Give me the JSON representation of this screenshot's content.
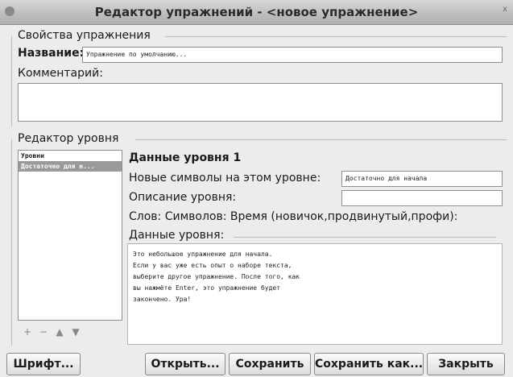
{
  "window": {
    "title": "Редактор упражнений - <новое упражнение>",
    "close_label": "x"
  },
  "properties": {
    "section_title": "Свойства упражнения",
    "name_label": "Название:",
    "name_value": "Упражнение по умолчанию...",
    "comment_label": "Комментарий:",
    "comment_value": ""
  },
  "level_editor": {
    "section_title": "Редактор уровня",
    "list_items": [
      {
        "label": "Уровни",
        "kind": "header"
      },
      {
        "label": "Достаточно для н...",
        "kind": "selected"
      }
    ],
    "level_title": "Данные уровня 1",
    "new_symbols_label": "Новые символы на этом уровне:",
    "new_symbols_value": "Достаточно для начала",
    "description_label": "Описание уровня:",
    "description_value": "",
    "stats_label": "Слов: Символов: Время (новичок,продвинутый,профи):",
    "data_label": "Данные уровня:",
    "data_text": "Это небольшое упражнение для начала.\nЕсли у вас уже есть опыт о наборе текста,\nвыберите другое упражнение. После того, как\nвы нажмёте Enter, это упражнение будет\nзакончено. Ура!",
    "tool_icons": [
      "add-icon",
      "remove-icon",
      "move-up-icon",
      "move-down-icon"
    ]
  },
  "buttons": {
    "font": "Шрифт...",
    "open": "Открыть...",
    "save": "Сохранить",
    "save_as": "Сохранить как...",
    "close": "Закрыть"
  }
}
